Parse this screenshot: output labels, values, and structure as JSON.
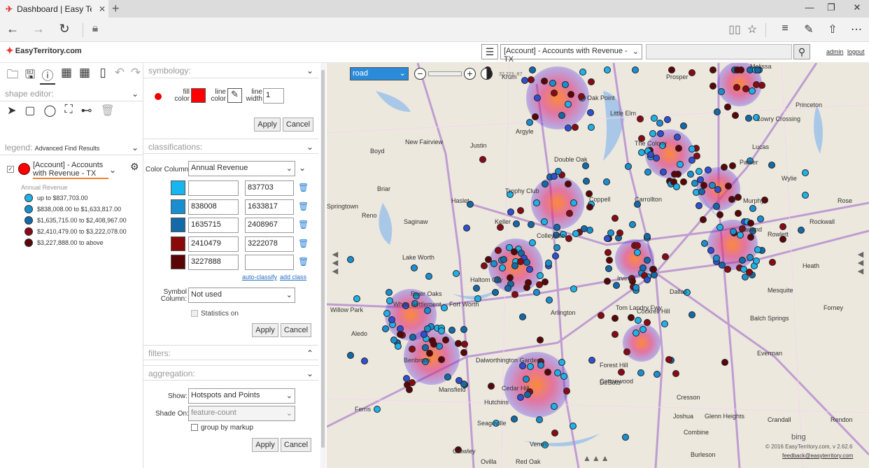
{
  "browser": {
    "tab_title": "Dashboard | Easy Territo",
    "new_tab": "+",
    "close": "✕"
  },
  "app": {
    "brand": "EasyTerritory.com",
    "layer_selected": "[Account] - Accounts with Revenue - TX",
    "links": {
      "admin": "admin",
      "logout": "logout"
    }
  },
  "left": {
    "shape_editor": "shape editor:",
    "legend_label": "legend:",
    "legend_value": "Advanced Find Results",
    "layer_name": "[Account] - Accounts with Revenue - TX",
    "legend_title": "Annual Revenue",
    "legend": [
      {
        "label": "up to $837,703.00",
        "color": "#1fb2e8"
      },
      {
        "label": "$838,008.00 to $1,633,817.00",
        "color": "#1a8fd0"
      },
      {
        "label": "$1,635,715.00 to $2,408,967.00",
        "color": "#146aa8"
      },
      {
        "label": "$2,410,479.00 to $3,222,078.00",
        "color": "#8a0a14"
      },
      {
        "label": "$3,227,888.00 to above",
        "color": "#5a0608"
      }
    ]
  },
  "symbology": {
    "header": "symbology:",
    "fill_color_label": "fill color",
    "line_color_label": "line color",
    "line_width_label": "line width",
    "line_width_value": "1",
    "fill_color": "#ff0000",
    "apply": "Apply",
    "cancel": "Cancel"
  },
  "classifications": {
    "header": "classifications:",
    "color_column_label": "Color Column:",
    "color_column_value": "Annual Revenue",
    "rows": [
      {
        "color": "#18b6ee",
        "from": "",
        "to": "837703"
      },
      {
        "color": "#1a8fd0",
        "from": "838008",
        "to": "1633817"
      },
      {
        "color": "#146aa8",
        "from": "1635715",
        "to": "2408967"
      },
      {
        "color": "#8a0a0a",
        "from": "2410479",
        "to": "3222078"
      },
      {
        "color": "#5a0505",
        "from": "3227888",
        "to": ""
      }
    ],
    "auto_classify": "auto-classify",
    "add_class": "add class",
    "symbol_column_label": "Symbol Column:",
    "symbol_column_value": "Not used",
    "statistics_on": "Statistics on",
    "apply": "Apply",
    "cancel": "Cancel"
  },
  "filters": {
    "header": "filters:"
  },
  "aggregation": {
    "header": "aggregation:",
    "show_label": "Show:",
    "show_value": "Hotspots and Points",
    "shade_label": "Shade On:",
    "shade_value": "feature-count",
    "group_by_markup": "group by markup",
    "apply": "Apply",
    "cancel": "Cancel"
  },
  "map": {
    "style_value": "road",
    "coords": "32.223,-97",
    "copyright": "© 2016 EasyTerritory.com, v 2.62.6",
    "feedback": "feedback@easyterritory.com",
    "bing": "bing",
    "places": [
      "Krum",
      "Prosper",
      "Melissa",
      "Oak Point",
      "Little Elm",
      "Princeton",
      "Argyle",
      "The Colony",
      "Lowry Crossing",
      "New Fairview",
      "Justin",
      "Lucas",
      "Boyd",
      "Double Oak",
      "Parker",
      "Wylie",
      "Briar",
      "Trophy Club",
      "Murphy",
      "Haslet",
      "Coppell",
      "Carrollton",
      "Rose",
      "Reno",
      "Springtown",
      "Saginaw",
      "Keller",
      "Colleyville",
      "Garland",
      "Rowlett",
      "Rockwall",
      "Lake Worth",
      "River Oaks",
      "Haltom City",
      "Irving",
      "Dallas",
      "Mesquite",
      "Heath",
      "Willow Park",
      "White Settlement",
      "Fort Worth",
      "Tom Landry Fwy",
      "Cockrell Hill",
      "Forney",
      "Aledo",
      "Arlington",
      "Balch Springs",
      "Benbrook",
      "Dalworthington Gardens",
      "Forest Hill",
      "Everman",
      "Hutchins",
      "Seagoville",
      "Crandall",
      "Crowley",
      "Rendon",
      "Mansfield",
      "Cedar Hill",
      "DeSoto",
      "Combine",
      "Cresson",
      "Burleson",
      "Glenn Heights",
      "Ferris",
      "Ovilla",
      "Red Oak",
      "Joshua",
      "Venus",
      "Cottonwood"
    ]
  }
}
